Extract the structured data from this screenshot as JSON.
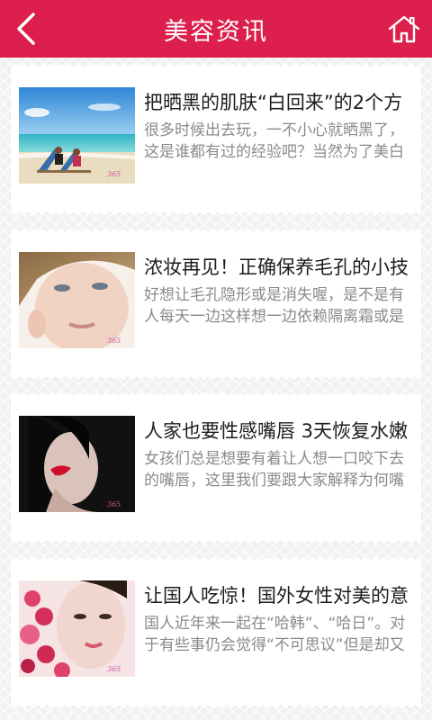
{
  "header": {
    "title": "美容资讯",
    "back_icon": "chevron-left-icon",
    "home_icon": "home-icon",
    "background": "#dc1f4c"
  },
  "articles": [
    {
      "title": "把晒黑的肌肤“白回来”的2个方",
      "summary": "很多时候出去玩，一不小心就晒黑了，这是谁都有过的经验吧？当然为了美白",
      "image": "beach-lounge-chairs"
    },
    {
      "title": "浓妆再见！正确保养毛孔的小技",
      "summary": "好想让毛孔隐形或是消失喔，是不是有人每天一边这样想一边依赖隔离霜或是",
      "image": "blonde-woman-face"
    },
    {
      "title": "人家也要性感嘴唇 3天恢复水嫩",
      "summary": "女孩们总是想要有着让人想一口咬下去的嘴唇，这里我们要跟大家解释为何嘴",
      "image": "woman-red-lips"
    },
    {
      "title": "让国人吃惊！国外女性对美的意",
      "summary": "国人近年来一起在“哈韩”、“哈日”。对于有些事仍会觉得“不可思议”但是却又",
      "image": "woman-rose-petals"
    }
  ]
}
